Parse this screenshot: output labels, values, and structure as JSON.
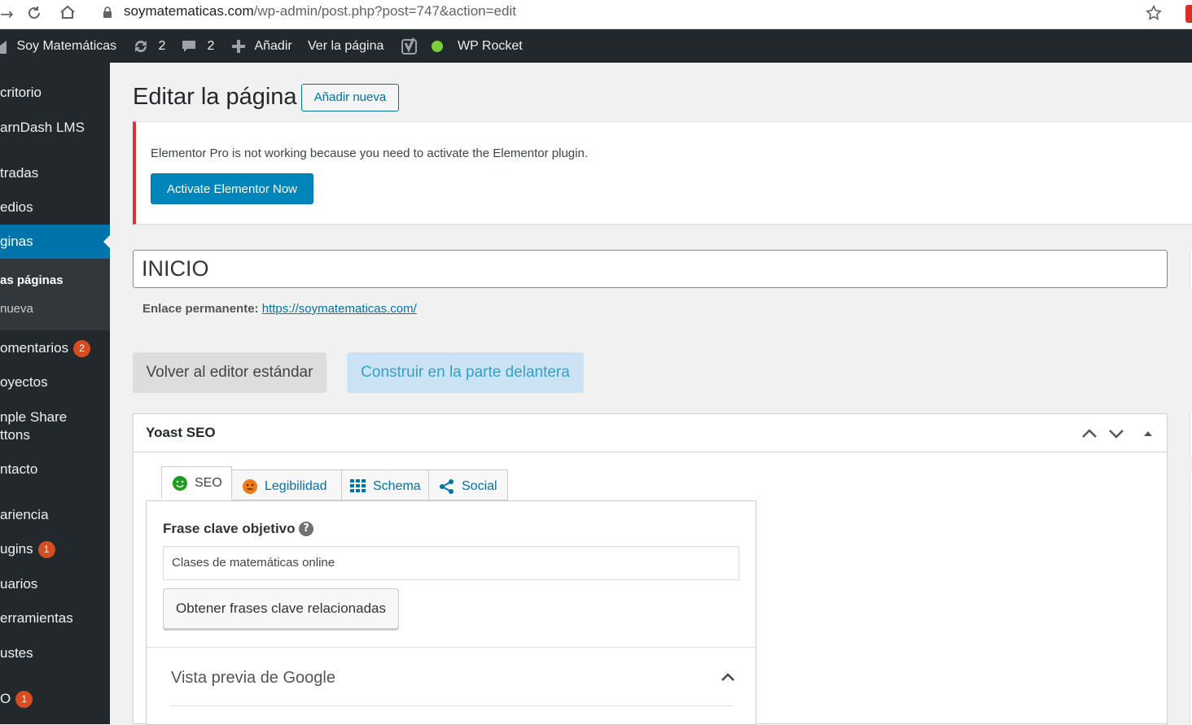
{
  "browser": {
    "url_host": "soymatematicas.com",
    "url_path": "/wp-admin/post.php?post=747&action=edit"
  },
  "adminbar": {
    "site_name": "Soy Matemáticas",
    "updates_count": "2",
    "comments_count": "2",
    "add_label": "Añadir",
    "view_page": "Ver la página",
    "wp_rocket": "WP Rocket"
  },
  "sidebar": {
    "items": [
      {
        "label": "critorio"
      },
      {
        "label": "arnDash LMS"
      },
      {
        "label": "tradas"
      },
      {
        "label": "edios"
      },
      {
        "label": "ginas"
      },
      {
        "label": "omentarios",
        "badge": "2"
      },
      {
        "label": "oyectos"
      },
      {
        "label": "nple Share"
      },
      {
        "label": "ttons"
      },
      {
        "label": "ntacto"
      },
      {
        "label": "ariencia"
      },
      {
        "label": "ugins",
        "badge": "1"
      },
      {
        "label": "uarios"
      },
      {
        "label": "erramientas"
      },
      {
        "label": "ustes"
      },
      {
        "label": "O",
        "badge": "1"
      }
    ],
    "submenu": {
      "all_pages": "as páginas",
      "add_new": "nueva"
    }
  },
  "main": {
    "page_title": "Editar la página",
    "add_new_button": "Añadir nueva",
    "notice": {
      "text": "Elementor Pro is not working because you need to activate the Elementor plugin.",
      "button": "Activate Elementor Now"
    },
    "title_value": "INICIO",
    "permalink_label": "Enlace permanente:",
    "permalink_url": "https://soymatematicas.com/",
    "btn_standard_editor": "Volver al editor estándar",
    "btn_frontend": "Construir en la parte delantera"
  },
  "yoast": {
    "title": "Yoast SEO",
    "tabs": [
      {
        "label": "SEO"
      },
      {
        "label": "Legibilidad"
      },
      {
        "label": "Schema"
      },
      {
        "label": "Social"
      }
    ],
    "focus_keyphrase_label": "Frase clave objetivo",
    "focus_keyphrase_value": "Clases de matemáticas online",
    "related_button": "Obtener frases clave relacionadas",
    "google_preview": "Vista previa de Google"
  },
  "colors": {
    "admin_dark": "#23282d",
    "wp_blue": "#0073aa",
    "notice_red": "#dc3232",
    "badge_orange": "#d54e21",
    "yoast_green": "#7ad03a",
    "yoast_orange": "#ee7c1b"
  }
}
